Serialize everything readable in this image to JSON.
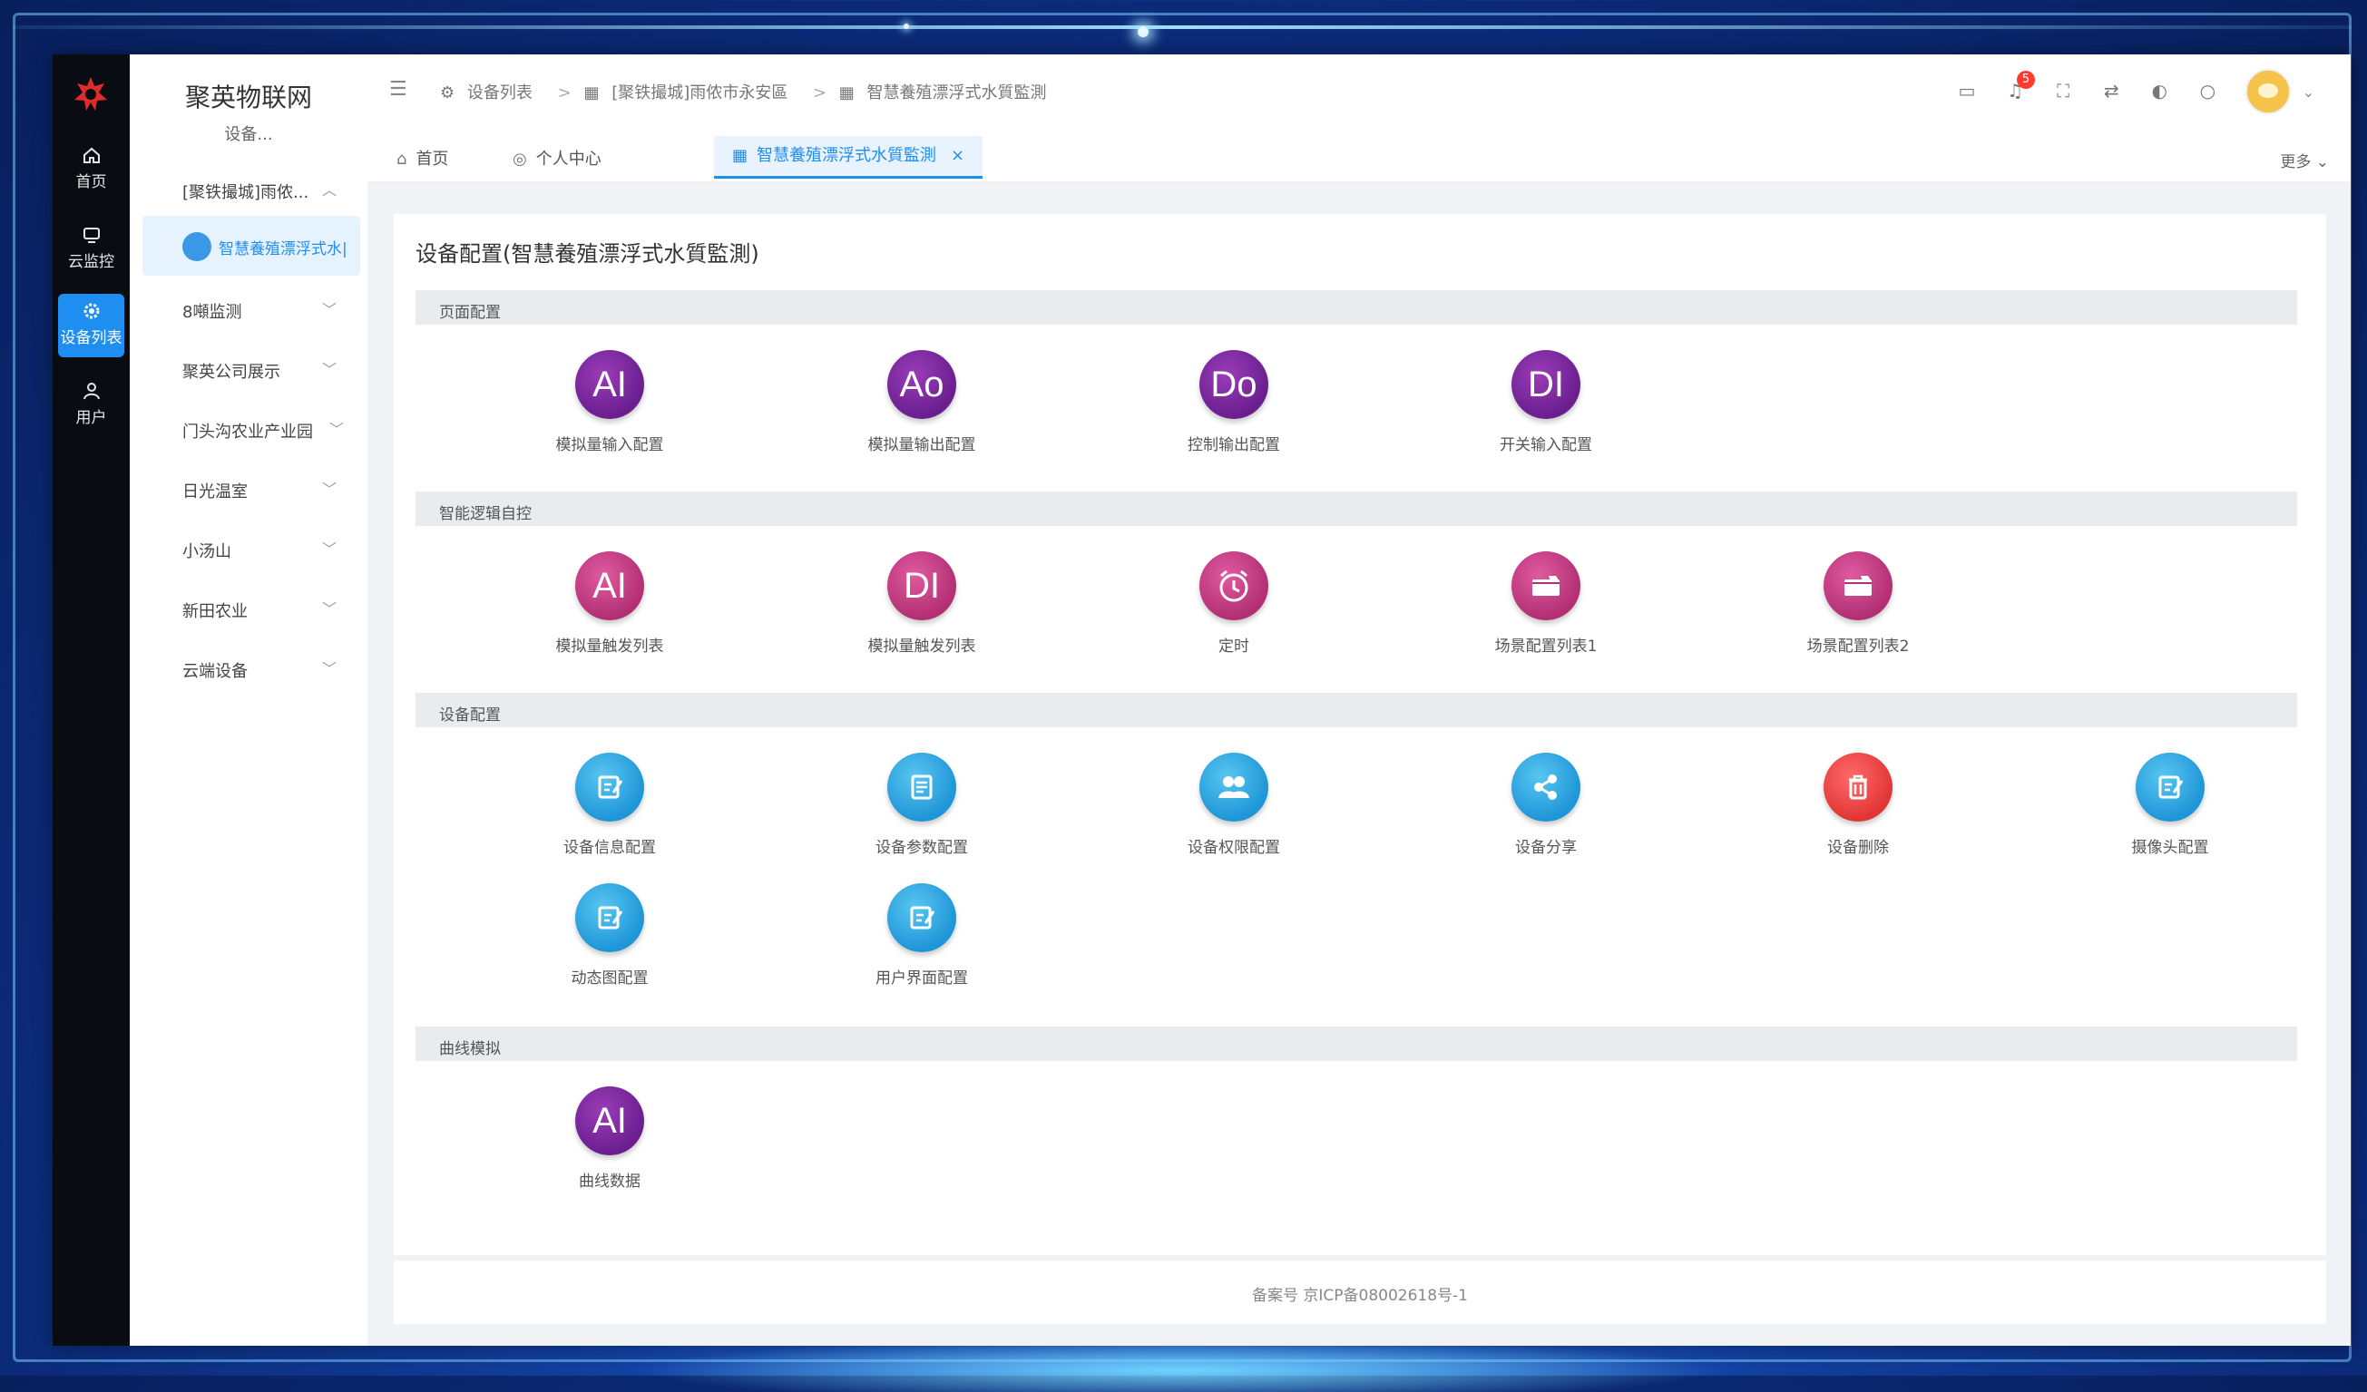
{
  "rail": {
    "items": [
      {
        "label": "首页",
        "icon": "home-icon"
      },
      {
        "label": "云监控",
        "icon": "monitor-icon"
      },
      {
        "label": "设备列表",
        "icon": "gear-icon",
        "active": true
      },
      {
        "label": "用户",
        "icon": "user-icon"
      }
    ]
  },
  "sidebar": {
    "brand": "聚英物联网",
    "brand_sub": "设备...",
    "items": [
      {
        "label": "[聚铁撮城]雨侬..."
      },
      {
        "label": "智慧養殖漂浮式水|"
      },
      {
        "label": "8噸监测"
      },
      {
        "label": "聚英公司展示"
      },
      {
        "label": "门头沟农业产业园"
      },
      {
        "label": "日光温室"
      },
      {
        "label": "小汤山"
      },
      {
        "label": "新田农业"
      },
      {
        "label": "云端设备"
      }
    ]
  },
  "header": {
    "breadcrumbs": [
      "设备列表",
      "[聚铁撮城]雨侬市永安區",
      "智慧養殖漂浮式水質監測"
    ],
    "notification_count": "5"
  },
  "tabs": {
    "items": [
      "首页",
      "个人中心",
      "智慧養殖漂浮式水質監測"
    ],
    "more": "更多"
  },
  "panel": {
    "title": "设备配置(智慧養殖漂浮式水質監測)",
    "sections": [
      {
        "label": "页面配置",
        "items": [
          {
            "glyph": "AI",
            "label": "模拟量输入配置"
          },
          {
            "glyph": "Ao",
            "label": "模拟量输出配置"
          },
          {
            "glyph": "Do",
            "label": "控制输出配置"
          },
          {
            "glyph": "DI",
            "label": "开关输入配置"
          }
        ]
      },
      {
        "label": "智能逻辑自控",
        "items": [
          {
            "glyph": "AI",
            "label": "模拟量触发列表"
          },
          {
            "glyph": "DI",
            "label": "模拟量触发列表"
          },
          {
            "glyph": "",
            "label": "定时"
          },
          {
            "glyph": "",
            "label": "场景配置列表1"
          },
          {
            "glyph": "",
            "label": "场景配置列表2"
          }
        ]
      },
      {
        "label": "设备配置",
        "items": [
          {
            "label": "设备信息配置"
          },
          {
            "label": "设备参数配置"
          },
          {
            "label": "设备权限配置"
          },
          {
            "label": "设备分享"
          },
          {
            "label": "设备删除"
          },
          {
            "label": "摄像头配置"
          },
          {
            "label": "动态图配置"
          },
          {
            "label": "用户界面配置"
          }
        ]
      },
      {
        "label": "曲线模拟",
        "items": [
          {
            "glyph": "AI",
            "label": "曲线数据"
          }
        ]
      }
    ]
  },
  "footer": {
    "text": "备案号 京ICP备08002618号-1"
  },
  "colors": {
    "accent": "#1f8ef1",
    "purple": "#6a1f8f",
    "pink": "#b32f73",
    "blue": "#1f96d8",
    "red": "#e23535"
  }
}
